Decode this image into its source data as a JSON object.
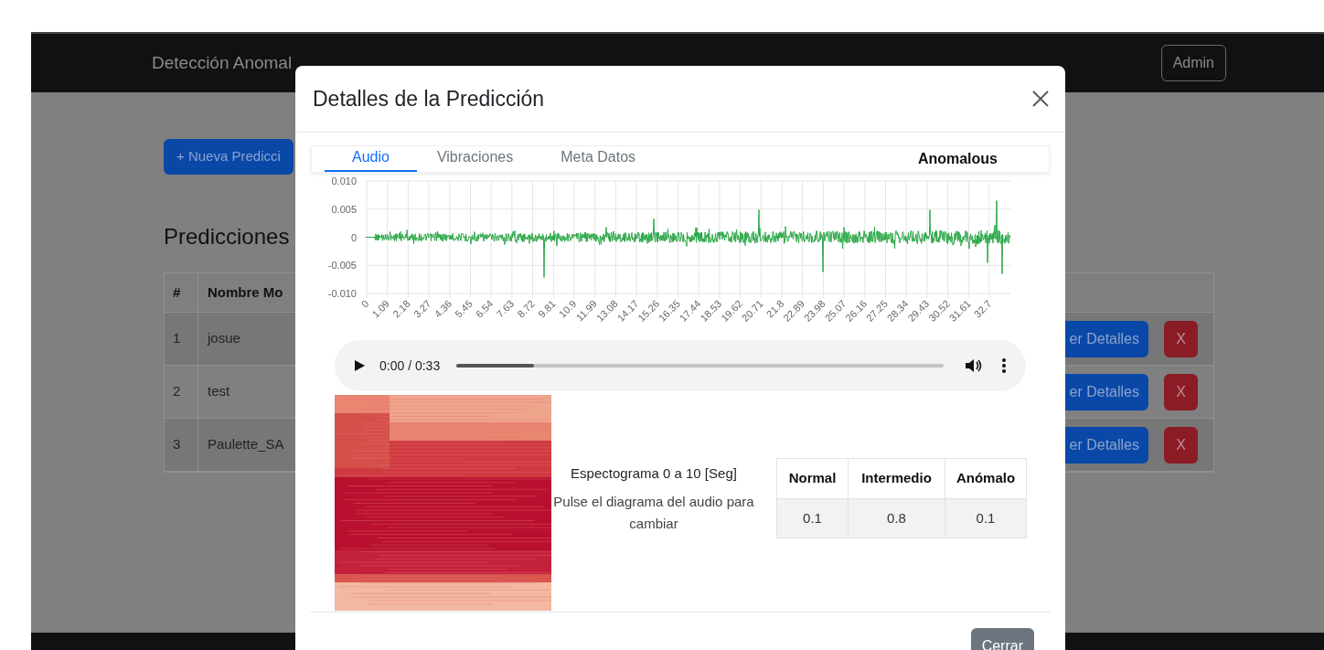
{
  "navbar": {
    "title": "Detección Anomal",
    "user_button": "Admin"
  },
  "new_button": "+ Nueva Predicci",
  "section_title": "Predicciones",
  "table": {
    "columns": [
      "#",
      "Nombre Mo"
    ],
    "rows": [
      {
        "index": "1",
        "name": "josue",
        "details_button": "er Detalles",
        "delete_button": "X"
      },
      {
        "index": "2",
        "name": "test",
        "details_button": "er Detalles",
        "delete_button": "X"
      },
      {
        "index": "3",
        "name": "Paulette_SA",
        "details_button": "er Detalles",
        "delete_button": "X"
      }
    ]
  },
  "modal": {
    "title": "Detalles de la Predicción",
    "tabs": [
      {
        "label": "Audio",
        "selected": true
      },
      {
        "label": "Vibraciones",
        "selected": false
      },
      {
        "label": "Meta Datos",
        "selected": false
      }
    ],
    "status": "Anomalous",
    "waveform": {
      "y_ticks": [
        "0.010",
        "0.005",
        "0",
        "-0.005",
        "-0.010"
      ],
      "x_ticks": [
        "0",
        "1.09",
        "2.18",
        "3.27",
        "4.36",
        "5.45",
        "6.54",
        "7.63",
        "8.72",
        "9.81",
        "10.9",
        "11.99",
        "13.08",
        "14.17",
        "15.26",
        "16.35",
        "17.44",
        "18.53",
        "19.62",
        "20.71",
        "21.8",
        "22.89",
        "23.98",
        "25.07",
        "26.16",
        "27.25",
        "28.34",
        "29.43",
        "30.52",
        "31.61",
        "32.7"
      ]
    },
    "audio_player": {
      "time": "0:00 / 0:33",
      "level": 0.16
    },
    "spectrogram": {
      "caption": "Espectograma 0 a 10 [Seg]",
      "hint": "Pulse el diagrama del audio para cambiar"
    },
    "scores": {
      "columns": [
        "Normal",
        "Intermedio",
        "Anómalo"
      ],
      "values": [
        "0.1",
        "0.8",
        "0.1"
      ]
    },
    "close_button": "Cerrar"
  }
}
